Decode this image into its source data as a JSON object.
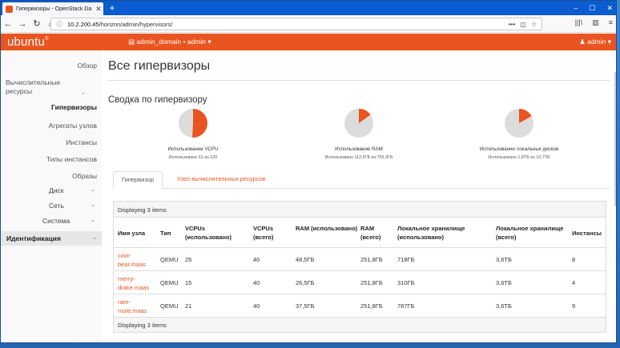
{
  "browser": {
    "tab_title": "Гипервизоры - OpenStack Da",
    "tab_close": "✕",
    "new_tab": "+",
    "win_min": "–",
    "win_max": "☐",
    "win_close": "✕",
    "back": "←",
    "forward": "→",
    "reload": "↻",
    "home": "⌂",
    "url_host": "10.2.200.45",
    "url_path": "/horizon/admin/hypervisors/",
    "url_menu": "•••",
    "bookmark": "☆",
    "pocket": "◫",
    "library": "|||\\",
    "sidebar_toggle": "▥",
    "menu": "≡"
  },
  "header": {
    "logo": "ubuntu",
    "logo_mark": "®",
    "domain_menu": "admin_domain • admin ▾",
    "user_menu": "admin ▾",
    "brand_color": "#e95420"
  },
  "sidebar": {
    "overview": "Обзор",
    "compute": "Вычислительные ресурсы",
    "hypervisors": "Гипервизоры",
    "host_aggregates": "Агрегаты узлов",
    "instances": "Инстансы",
    "flavors": "Типы инстансов",
    "images": "Образы",
    "volume": "Диск",
    "network": "Сеть",
    "system": "Система",
    "identity": "Идентификация"
  },
  "page": {
    "title": "Все гипервизоры",
    "summary_title": "Сводка по гипервизору"
  },
  "usage": [
    {
      "label": "Использование VCPU",
      "sub": "Использовано 61 из 120",
      "fraction": 0.508
    },
    {
      "label": "Использование RAM",
      "sub": "Использовано 112,5ГБ из 755,3ГБ",
      "fraction": 0.149
    },
    {
      "label": "Использование локальных дисков",
      "sub": "Использовано 1,8ТБ из 10,7ТБ",
      "fraction": 0.168
    }
  ],
  "tabs": {
    "hypervisor": "Гипервизор",
    "compute_host": "Узел вычислительных ресурсов"
  },
  "table": {
    "caption": "Displaying 3 items",
    "footer": "Displaying 3 items",
    "columns": [
      "Имя узла",
      "Тип",
      "VCPUs (использовано)",
      "VCPUs (всего)",
      "RAM (использовано)",
      "RAM (всего)",
      "Локальное хранилище (использовано)",
      "Локальное хранилище (всего)",
      "Инстансы"
    ],
    "rows": [
      [
        "cool-bear.maas",
        "QEMU",
        "25",
        "40",
        "48,5ГБ",
        "251,8ГБ",
        "718ГБ",
        "3,6ТБ",
        "8"
      ],
      [
        "merry-drake.maas",
        "QEMU",
        "15",
        "40",
        "26,5ГБ",
        "251,8ГБ",
        "310ГБ",
        "3,6ТБ",
        "4"
      ],
      [
        "rare-mule.maas",
        "QEMU",
        "21",
        "40",
        "37,5ГБ",
        "251,8ГБ",
        "787ГБ",
        "3,6ТБ",
        "9"
      ]
    ]
  }
}
